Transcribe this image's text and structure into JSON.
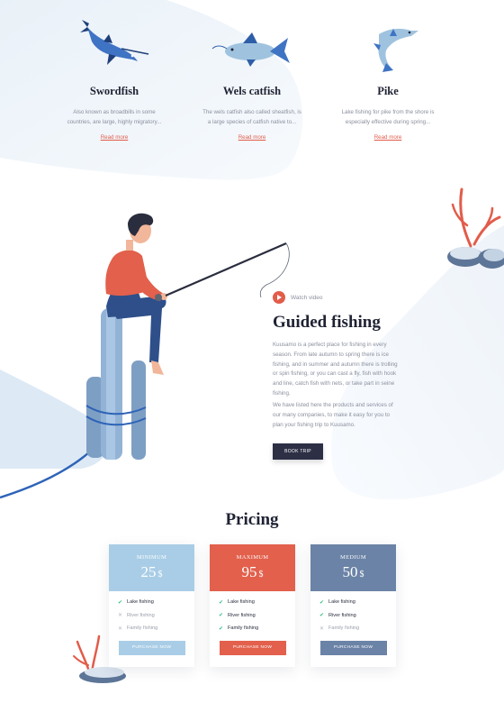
{
  "fish": [
    {
      "name": "Swordfish",
      "desc": "Also known as broadbills in some countries, are large, highly migratory...",
      "link": "Read more",
      "icon": "swordfish-icon"
    },
    {
      "name": "Wels catfish",
      "desc": "The wels catfish also called sheatfish, is a large species of catfish native to...",
      "link": "Read more",
      "icon": "catfish-icon"
    },
    {
      "name": "Pike",
      "desc": "Lake fishing for pike from the shore is especially effective during spring...",
      "link": "Read more",
      "icon": "pike-icon"
    }
  ],
  "guided": {
    "watch_label": "Watch video",
    "title": "Guided fishing",
    "para1": "Kuusamo is a perfect place for fishing in every season. From late autumn to spring there is ice fishing, and in summer and autumn there is trolling or spin fishing, or you can cast a fly, fish with hook and line, catch fish with nets, or take part in seine fishing.",
    "para2": "We have listed here the products and services of our many companies, to make it easy for you to plan your fishing trip to Kuusamo.",
    "button": "BOOK TRIP"
  },
  "pricing": {
    "title": "Pricing",
    "plans": [
      {
        "name": "MINIMUM",
        "price": "25",
        "currency": "$",
        "color": "#a9cde6",
        "btn_color": "#a9cde6",
        "features": [
          {
            "label": "Lake fishing",
            "included": true
          },
          {
            "label": "River fishing",
            "included": false
          },
          {
            "label": "Family fishing",
            "included": false
          }
        ],
        "button": "PURCHASE NOW"
      },
      {
        "name": "MAXIMUM",
        "price": "95",
        "currency": "$",
        "color": "#e2604c",
        "btn_color": "#e2604c",
        "features": [
          {
            "label": "Lake fishing",
            "included": true
          },
          {
            "label": "River fishing",
            "included": true
          },
          {
            "label": "Family fishing",
            "included": true
          }
        ],
        "button": "PURCHASE NOW"
      },
      {
        "name": "MEDIUM",
        "price": "50",
        "currency": "$",
        "color": "#6b83a6",
        "btn_color": "#6b83a6",
        "features": [
          {
            "label": "Lake fishing",
            "included": true
          },
          {
            "label": "River fishing",
            "included": true
          },
          {
            "label": "Family fishing",
            "included": false
          }
        ],
        "button": "PURCHASE NOW"
      }
    ]
  },
  "colors": {
    "accent": "#e25c4a",
    "dark": "#2d2f45",
    "blue": "#3f73c4"
  }
}
